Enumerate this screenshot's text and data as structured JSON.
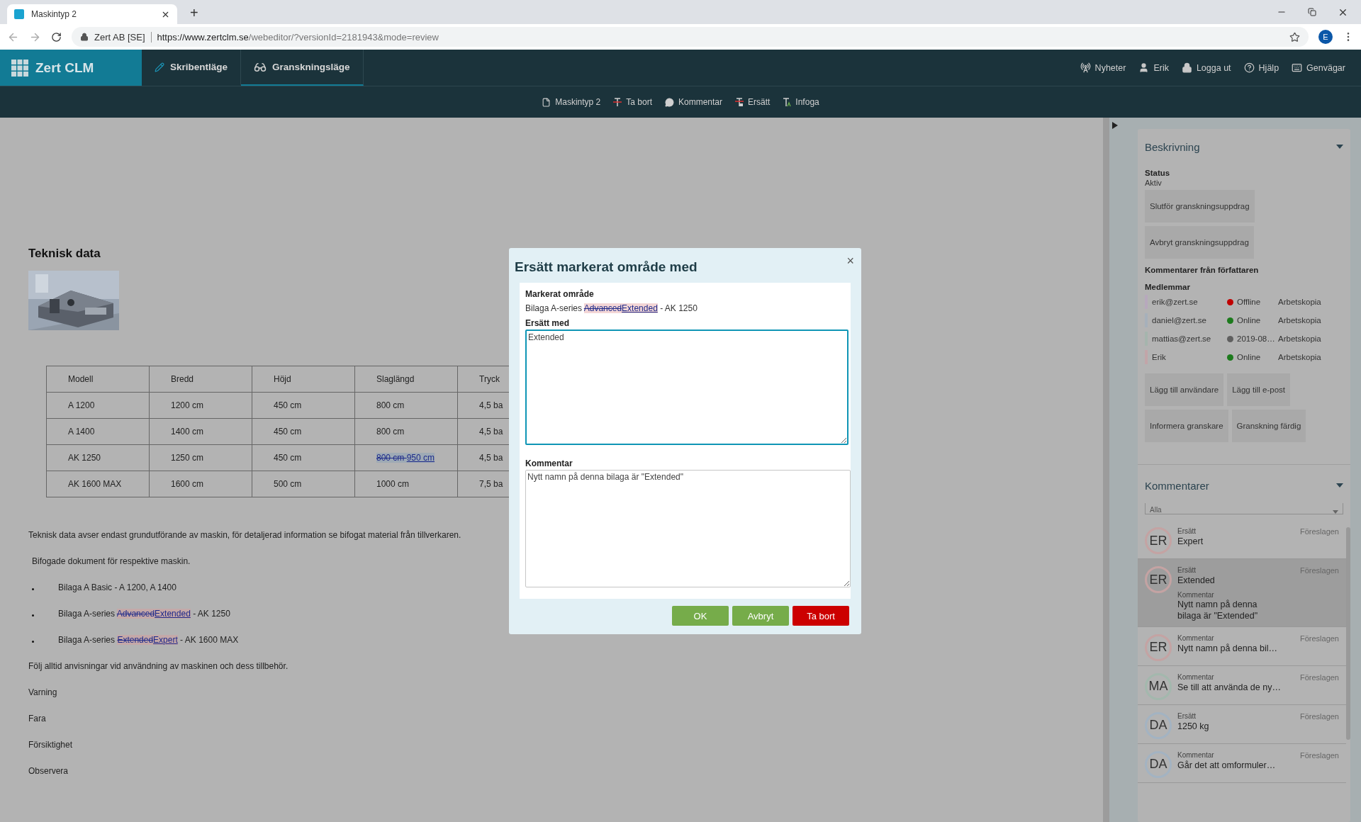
{
  "browser": {
    "tab": {
      "title": "Maskintyp 2",
      "selected": true
    },
    "new_tab": "+",
    "site_name": "Zert AB [SE]",
    "url": {
      "host": "https://www.zertclm.se",
      "path": "/webeditor/?versionId=2181943&mode=review"
    },
    "profile": "E"
  },
  "header": {
    "logo": "Zert CLM",
    "modes": [
      {
        "label": "Skribentläge",
        "selected": false
      },
      {
        "label": "Granskningsläge",
        "selected": true
      }
    ],
    "links": [
      "Nyheter",
      "Erik",
      "Logga ut",
      "Hjälp",
      "Genvägar"
    ]
  },
  "toolbar": [
    "Maskintyp 2",
    "Ta bort",
    "Kommentar",
    "Ersätt",
    "Infoga"
  ],
  "document": {
    "heading": "Teknisk data",
    "table": {
      "columns": [
        "Modell",
        "Bredd",
        "Höjd",
        "Slaglängd",
        "Tryck"
      ],
      "rows": [
        [
          "A 1200",
          "1200 cm",
          "450 cm",
          "800 cm",
          "4,5 ba"
        ],
        [
          "A 1400",
          "1400 cm",
          "450 cm",
          "800 cm",
          "4,5 ba"
        ],
        [
          "AK 1250",
          "1250 cm",
          "450 cm",
          {
            "deleted": "800 cm ",
            "inserted": "950 cm",
            "color": "#9eaab5"
          },
          "4,5 ba"
        ],
        [
          "AK 1600 MAX",
          "1600 cm",
          "500 cm",
          "1000 cm",
          "7,5 ba"
        ]
      ]
    },
    "paragraphs": [
      {
        "kind": "text",
        "text": "Teknisk data avser endast grundutförande av maskin, för detaljerad information se bifogat material från tillverkaren."
      },
      {
        "kind": "indent",
        "text": "Bifogade dokument för respektive maskin."
      },
      {
        "kind": "bullet",
        "before": "Bilaga A Basic - A 1200, A 1400"
      },
      {
        "kind": "bullet",
        "before": "Bilaga A-series ",
        "deleted": "Advanced",
        "inserted": "Extended",
        "color": "#c4a8a8",
        "after": " - AK 1250"
      },
      {
        "kind": "bullet",
        "before": "Bilaga A-series ",
        "deleted": "Extended",
        "inserted": "Expert",
        "color": "#c4a8a8",
        "after": " - AK 1600 MAX"
      },
      {
        "kind": "text",
        "text": "Följ alltid anvisningar vid användning av maskinen och dess tillbehör."
      },
      {
        "kind": "text",
        "text": "Varning"
      },
      {
        "kind": "text",
        "text": "Fara"
      },
      {
        "kind": "text",
        "text": "Försiktighet"
      },
      {
        "kind": "text",
        "text": "Observera"
      }
    ]
  },
  "dialog": {
    "title": "Ersätt markerat område med",
    "close": "×",
    "marked_label": "Markerat område",
    "marked": {
      "before": "Bilaga A-series ",
      "deleted": "Advanced",
      "inserted": "Extended",
      "color": "#f3d6d6",
      "after": " - AK 1250"
    },
    "replace_label": "Ersätt med",
    "replace_value": "Extended",
    "comment_label": "Kommentar",
    "comment_value": "Nytt namn på denna bilaga är \"Extended\"",
    "buttons": [
      {
        "label": "OK",
        "kind": "primary"
      },
      {
        "label": "Avbryt",
        "kind": "primary"
      },
      {
        "label": "Ta bort",
        "kind": "danger"
      }
    ]
  },
  "sidebar": {
    "description": {
      "title": "Beskrivning",
      "expanded": true,
      "status_label": "Status",
      "status_value": "Aktiv",
      "actions": [
        "Slutför granskningsuppdrag",
        "Avbryt granskningsuppdrag"
      ],
      "author_comments_label": "Kommentarer från författaren",
      "members_label": "Medlemmar",
      "members": [
        {
          "email": "erik@zert.se",
          "color": "#b7a8bd",
          "kind": "offline",
          "status": "Offline",
          "role": "Arbetskopia"
        },
        {
          "email": "daniel@zert.se",
          "color": "#a6b0bb",
          "kind": "online",
          "status": "Online",
          "role": "Arbetskopia"
        },
        {
          "email": "mattias@zert.se",
          "color": "#a5b5ad",
          "kind": "idle",
          "status": "2019-08…",
          "role": "Arbetskopia"
        },
        {
          "email": "Erik",
          "color": "#c2a5a8",
          "kind": "online",
          "status": "Online",
          "role": "Arbetskopia"
        }
      ],
      "member_actions": [
        [
          "Lägg till användare",
          "Lägg till e-post"
        ],
        [
          "Informera granskare",
          "Granskning färdig"
        ]
      ]
    },
    "comments": {
      "title": "Kommentarer",
      "expanded": true,
      "filter": "Alla",
      "items": [
        {
          "initials": "ER",
          "color": "#c4a3a3",
          "type": "Ersätt",
          "text": "Expert",
          "status": "Föreslagen",
          "selected": false
        },
        {
          "initials": "ER",
          "color": "#c4a3a3",
          "type": "Ersätt",
          "text": "Extended",
          "comment_label": "Kommentar",
          "comment": "Nytt namn på denna bilaga är \"Extended\"",
          "status": "Föreslagen",
          "selected": true
        },
        {
          "initials": "ER",
          "color": "#c4a3a3",
          "type": "Kommentar",
          "text": "Nytt namn på denna bil…",
          "status": "Föreslagen",
          "selected": false
        },
        {
          "initials": "MA",
          "color": "#a3b8ad",
          "type": "Kommentar",
          "text": "Se till att använda de ny…",
          "status": "Föreslagen",
          "selected": false
        },
        {
          "initials": "DA",
          "color": "#a3b3c2",
          "type": "Ersätt",
          "text": "1250 kg",
          "status": "Föreslagen",
          "selected": false
        },
        {
          "initials": "DA",
          "color": "#a3b3c2",
          "type": "Kommentar",
          "text": "Går det att omformuler…",
          "status": "Föreslagen",
          "selected": false
        }
      ]
    }
  }
}
